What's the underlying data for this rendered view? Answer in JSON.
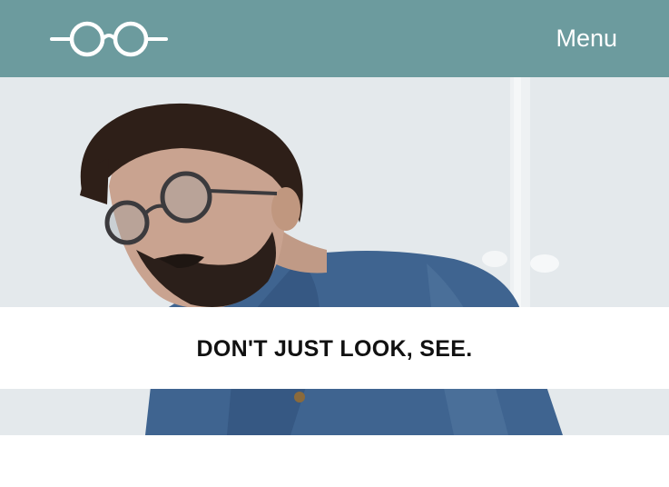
{
  "header": {
    "logo_icon": "eyeglasses-icon",
    "menu_label": "Menu",
    "background_color": "#6c9b9e"
  },
  "hero": {
    "image": "man-with-glasses-photo",
    "tagline": "DON'T JUST LOOK, SEE."
  }
}
